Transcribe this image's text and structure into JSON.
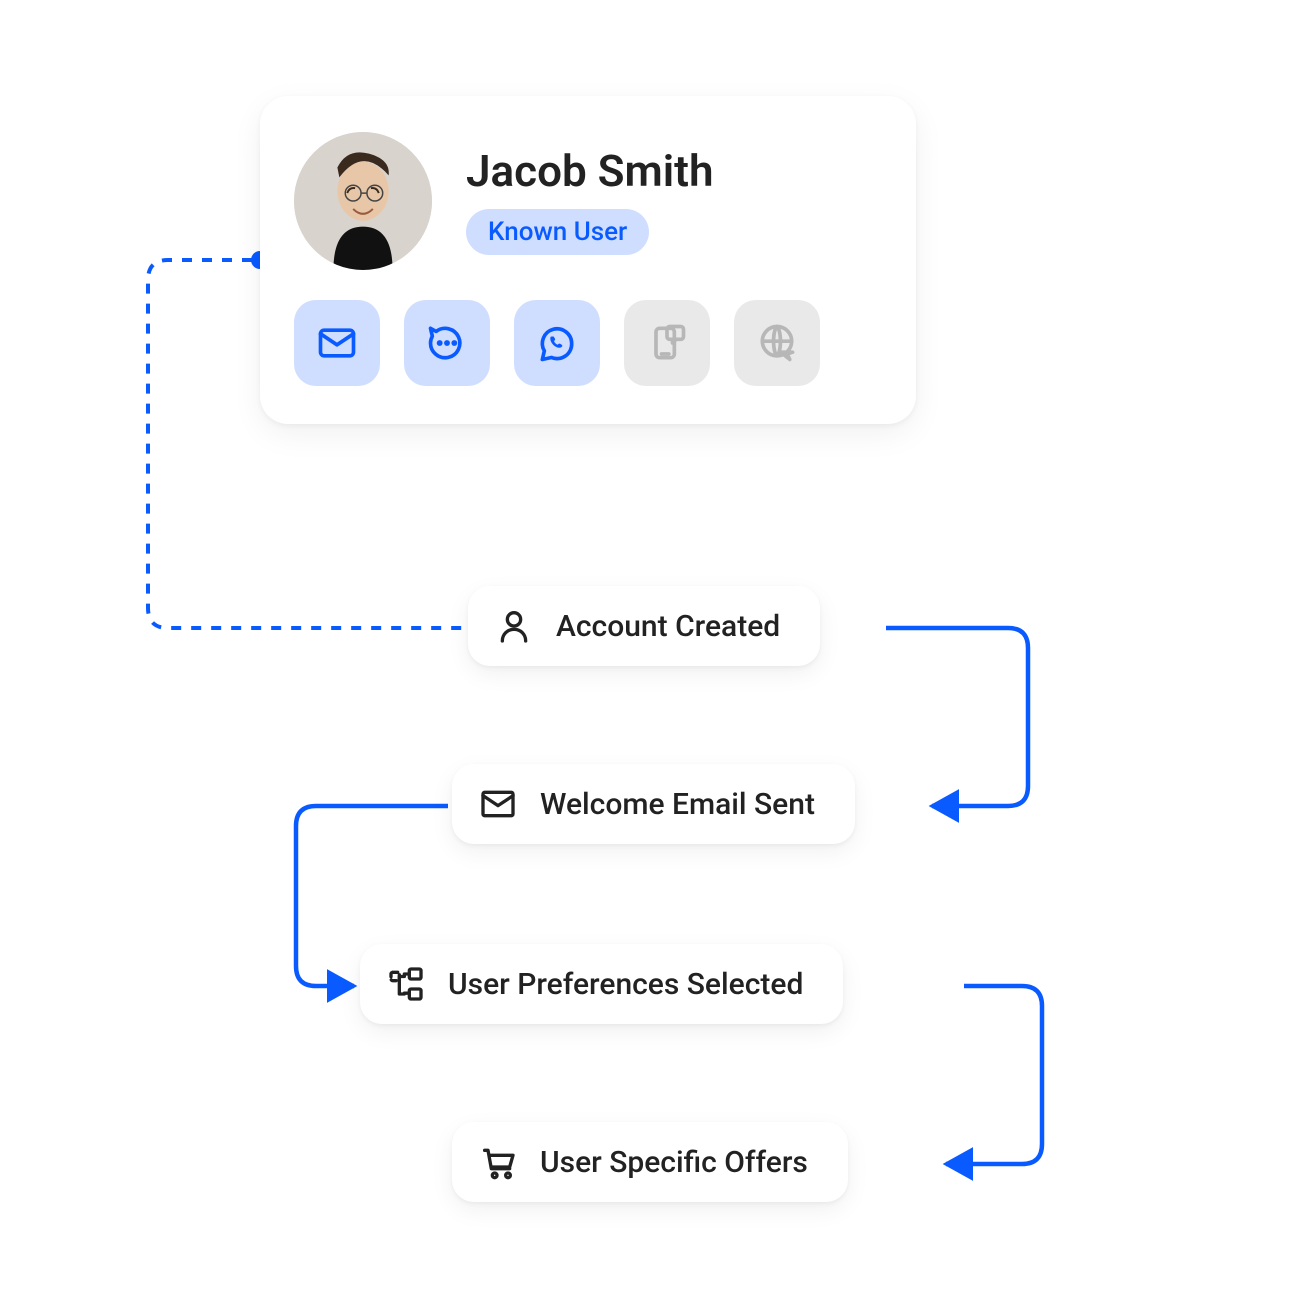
{
  "profile": {
    "name": "Jacob Smith",
    "badge": "Known User",
    "channels": [
      {
        "id": "email",
        "active": true
      },
      {
        "id": "chat",
        "active": true
      },
      {
        "id": "whatsapp",
        "active": true
      },
      {
        "id": "pushapp",
        "active": false
      },
      {
        "id": "web",
        "active": false
      }
    ]
  },
  "steps": [
    {
      "id": "account-created",
      "label": "Account Created",
      "icon": "user"
    },
    {
      "id": "welcome-email",
      "label": "Welcome Email Sent",
      "icon": "mail"
    },
    {
      "id": "preferences",
      "label": "User Preferences Selected",
      "icon": "tree"
    },
    {
      "id": "offers",
      "label": "User Specific Offers",
      "icon": "cart"
    }
  ],
  "colors": {
    "accent": "#0a5bff",
    "accent_soft": "#cfddff",
    "muted": "#b7b7b7",
    "muted_bg": "#e9e9e9"
  }
}
